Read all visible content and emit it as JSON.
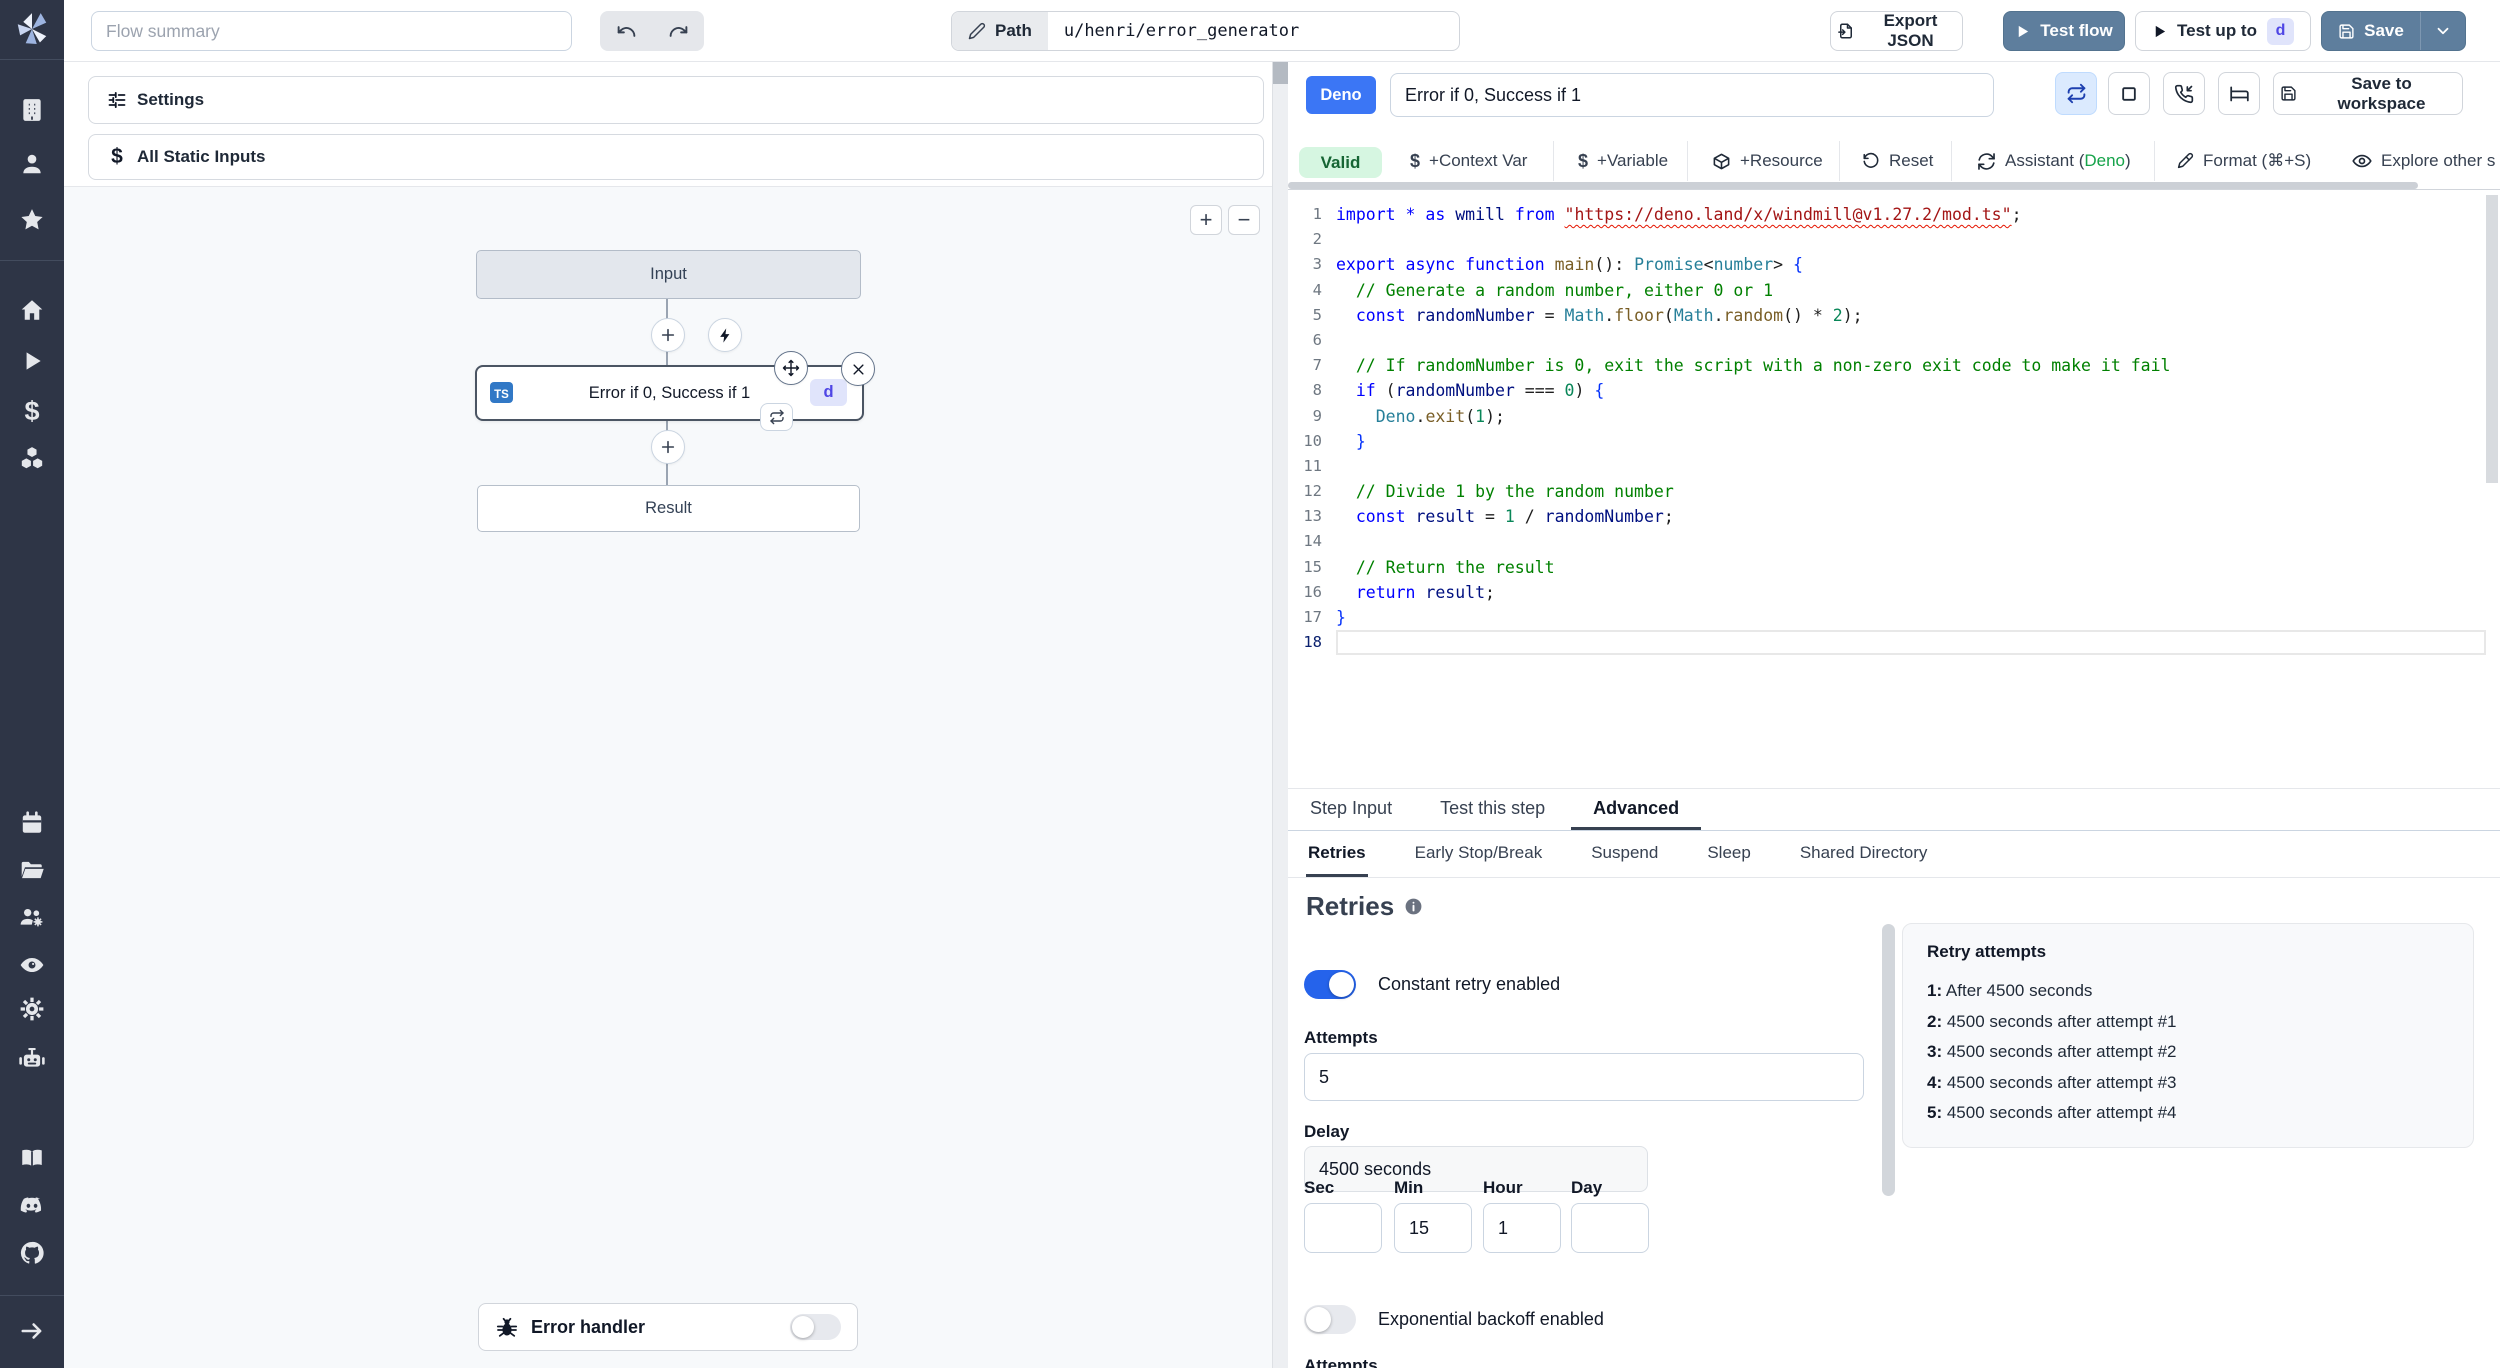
{
  "topbar": {
    "flow_summary_placeholder": "Flow summary",
    "path_label": "Path",
    "path_value": "u/henri/error_generator",
    "export_json": "Export JSON",
    "test_flow": "Test flow",
    "test_up_to": "Test up to",
    "test_up_to_badge": "d",
    "save": "Save"
  },
  "left_panel": {
    "settings": "Settings",
    "all_static_inputs": "All Static Inputs",
    "dollar_glyph": "$",
    "zoom_in": "+",
    "zoom_out": "−"
  },
  "flow": {
    "input_label": "Input",
    "step": {
      "lang_badge": "TS",
      "label": "Error if 0, Success if 1",
      "id_badge": "d"
    },
    "result_label": "Result",
    "error_handler_label": "Error handler",
    "error_handler_enabled": false
  },
  "right_panel": {
    "lang_badge": "Deno",
    "title_value": "Error if 0, Success if 1",
    "save_to_workspace": "Save to workspace",
    "toolbar": {
      "valid": "Valid",
      "dollar_glyph": "$",
      "context_var": "+Context Var",
      "variable": "+Variable",
      "resource": "+Resource",
      "reset": "Reset",
      "assistant_prefix": "Assistant (",
      "assistant_lang": "Deno",
      "assistant_suffix": ")",
      "format": "Format (⌘+S)",
      "explore": "Explore other s"
    }
  },
  "code": {
    "current_line": 18,
    "lines": [
      [
        [
          "kw",
          "import"
        ],
        [
          "p",
          " "
        ],
        [
          "kw",
          "*"
        ],
        [
          "p",
          " "
        ],
        [
          "kw",
          "as"
        ],
        [
          "p",
          " "
        ],
        [
          "v",
          "wmill"
        ],
        [
          "p",
          " "
        ],
        [
          "kw",
          "from"
        ],
        [
          "p",
          " "
        ],
        [
          "s sq",
          "\"https://deno.land/x/windmill@v1.27.2/mod.ts\""
        ],
        [
          "p",
          ";"
        ]
      ],
      [],
      [
        [
          "kw",
          "export"
        ],
        [
          "p",
          " "
        ],
        [
          "kw",
          "async"
        ],
        [
          "p",
          " "
        ],
        [
          "kw",
          "function"
        ],
        [
          "p",
          " "
        ],
        [
          "f",
          "main"
        ],
        [
          "p",
          "(): "
        ],
        [
          "c",
          "Promise"
        ],
        [
          "p",
          "<"
        ],
        [
          "c",
          "number"
        ],
        [
          "p",
          "> "
        ],
        [
          "b",
          "{"
        ]
      ],
      [
        [
          "cm",
          "  // Generate a random number, either 0 or 1"
        ]
      ],
      [
        [
          "p",
          "  "
        ],
        [
          "kw",
          "const"
        ],
        [
          "p",
          " "
        ],
        [
          "v",
          "randomNumber"
        ],
        [
          "p",
          " = "
        ],
        [
          "c",
          "Math"
        ],
        [
          "p",
          "."
        ],
        [
          "f",
          "floor"
        ],
        [
          "p",
          "("
        ],
        [
          "c",
          "Math"
        ],
        [
          "p",
          "."
        ],
        [
          "f",
          "random"
        ],
        [
          "p",
          "() * "
        ],
        [
          "n",
          "2"
        ],
        [
          "p",
          ");"
        ]
      ],
      [],
      [
        [
          "cm",
          "  // If randomNumber is 0, exit the script with a non-zero exit code to make it fail"
        ]
      ],
      [
        [
          "p",
          "  "
        ],
        [
          "kw",
          "if"
        ],
        [
          "p",
          " ("
        ],
        [
          "v",
          "randomNumber"
        ],
        [
          "p",
          " === "
        ],
        [
          "n",
          "0"
        ],
        [
          "p",
          ") "
        ],
        [
          "b",
          "{"
        ]
      ],
      [
        [
          "p",
          "    "
        ],
        [
          "c",
          "Deno"
        ],
        [
          "p",
          "."
        ],
        [
          "f",
          "exit"
        ],
        [
          "p",
          "("
        ],
        [
          "n",
          "1"
        ],
        [
          "p",
          ");"
        ]
      ],
      [
        [
          "p",
          "  "
        ],
        [
          "b",
          "}"
        ]
      ],
      [],
      [
        [
          "cm",
          "  // Divide 1 by the random number"
        ]
      ],
      [
        [
          "p",
          "  "
        ],
        [
          "kw",
          "const"
        ],
        [
          "p",
          " "
        ],
        [
          "v",
          "result"
        ],
        [
          "p",
          " = "
        ],
        [
          "n",
          "1"
        ],
        [
          "p",
          " / "
        ],
        [
          "v",
          "randomNumber"
        ],
        [
          "p",
          ";"
        ]
      ],
      [],
      [
        [
          "cm",
          "  // Return the result"
        ]
      ],
      [
        [
          "p",
          "  "
        ],
        [
          "kw",
          "return"
        ],
        [
          "p",
          " "
        ],
        [
          "v",
          "result"
        ],
        [
          "p",
          ";"
        ]
      ],
      [
        [
          "b",
          "}"
        ]
      ],
      []
    ]
  },
  "tabs": {
    "items": [
      "Step Input",
      "Test this step",
      "Advanced"
    ],
    "active": "Advanced"
  },
  "subtabs": {
    "items": [
      "Retries",
      "Early Stop/Break",
      "Suspend",
      "Sleep",
      "Shared Directory"
    ],
    "active": "Retries"
  },
  "retries": {
    "heading": "Retries",
    "constant_toggle_label": "Constant retry enabled",
    "constant_enabled": true,
    "attempts_label": "Attempts",
    "attempts_value": "5",
    "delay_label": "Delay",
    "delay_value": "4500 seconds",
    "duration_fields": [
      {
        "label": "Sec",
        "value": ""
      },
      {
        "label": "Min",
        "value": "15"
      },
      {
        "label": "Hour",
        "value": "1"
      },
      {
        "label": "Day",
        "value": ""
      }
    ],
    "exponential_toggle_label": "Exponential backoff enabled",
    "exponential_enabled": false,
    "clipped_label": "Attempts",
    "preview": {
      "title": "Retry attempts",
      "items": [
        {
          "n": "1:",
          "text": "After 4500 seconds"
        },
        {
          "n": "2:",
          "text": "4500 seconds after attempt #1"
        },
        {
          "n": "3:",
          "text": "4500 seconds after attempt #2"
        },
        {
          "n": "4:",
          "text": "4500 seconds after attempt #3"
        },
        {
          "n": "5:",
          "text": "4500 seconds after attempt #4"
        }
      ]
    }
  }
}
